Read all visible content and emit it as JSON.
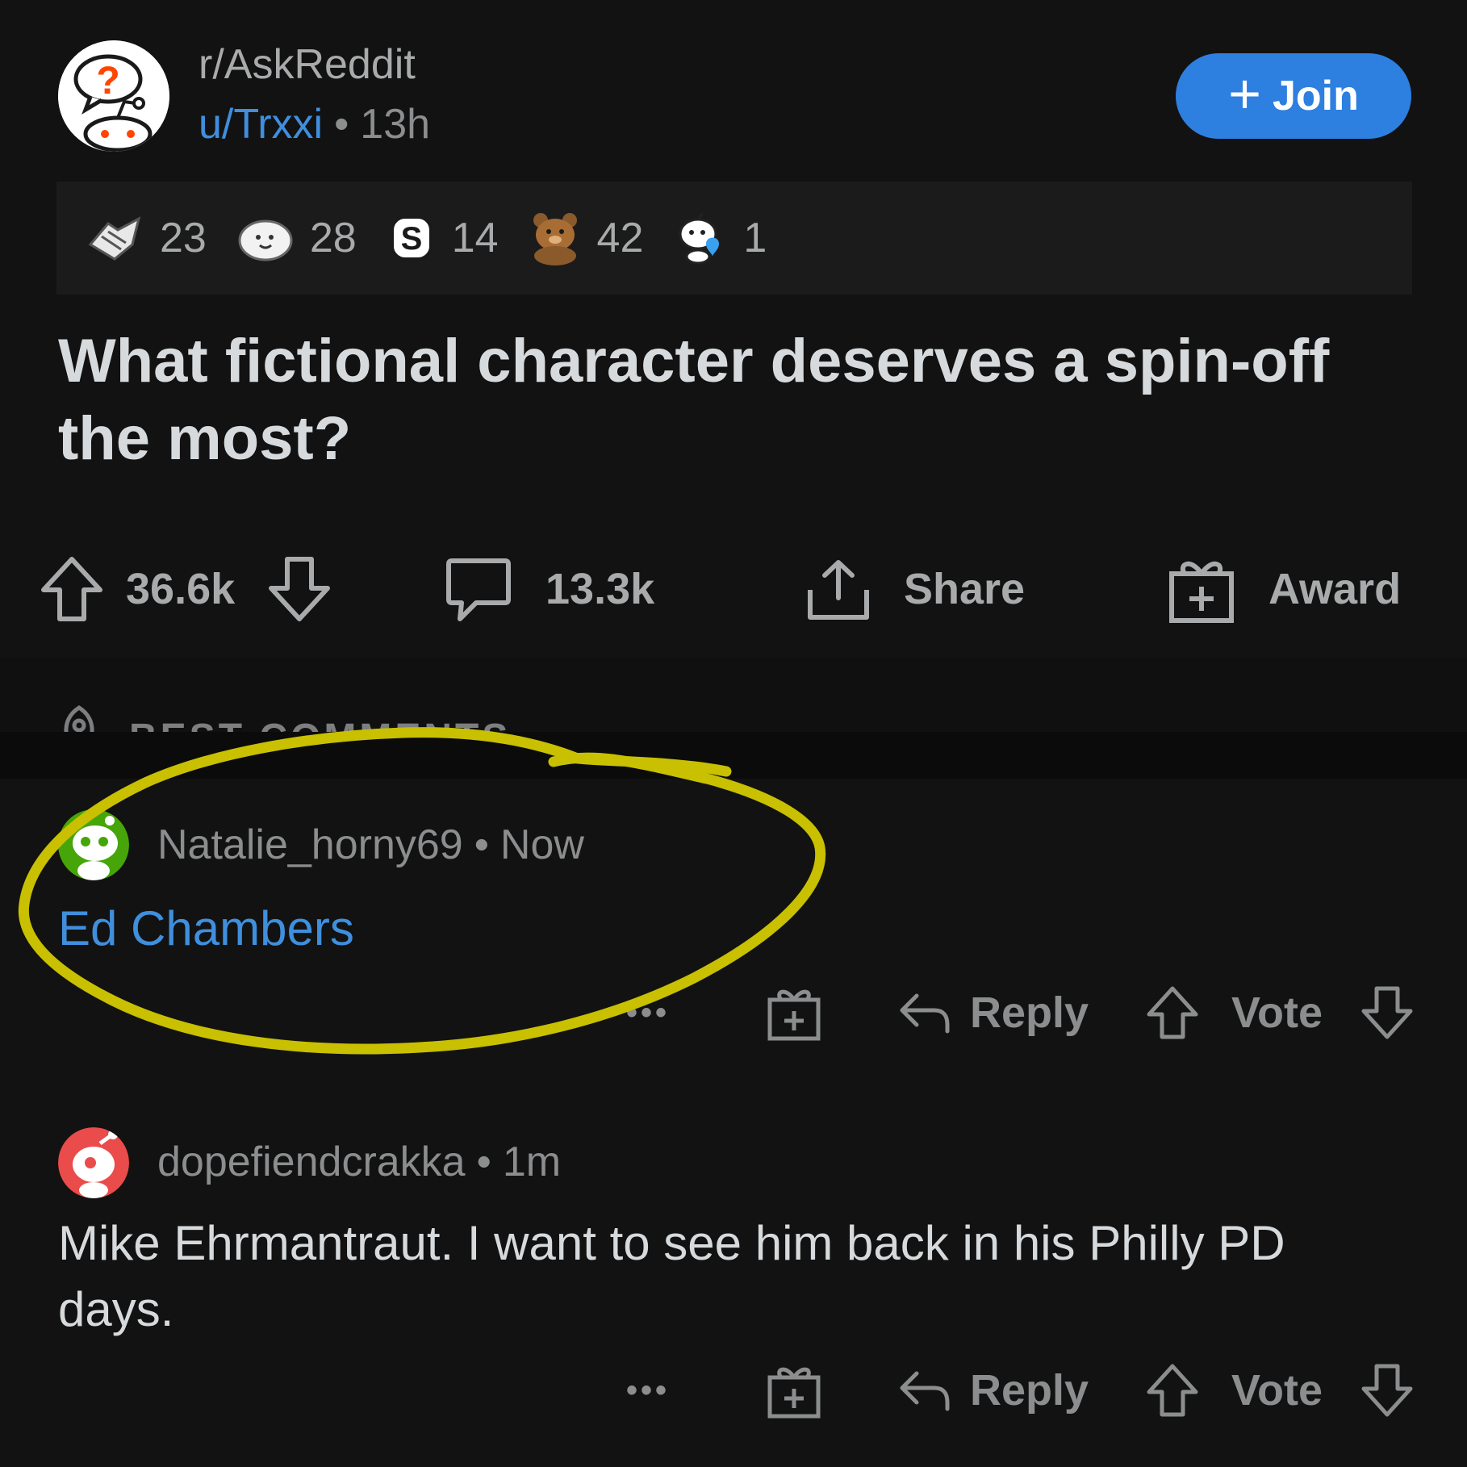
{
  "post": {
    "subreddit": "r/AskReddit",
    "author": "u/Trxxi",
    "age": "13h",
    "join_label": "Join",
    "title": "What fictional character deserves a spin-off the most?",
    "awards": [
      {
        "icon": "handshake-award-icon",
        "count": "23"
      },
      {
        "icon": "wholesome-seal-award-icon",
        "count": "28"
      },
      {
        "icon": "silver-coin-award-icon",
        "count": "14"
      },
      {
        "icon": "bear-award-icon",
        "count": "42"
      },
      {
        "icon": "snoo-heart-award-icon",
        "count": "1"
      }
    ],
    "upvotes": "36.6k",
    "comments": "13.3k",
    "share_label": "Share",
    "award_label": "Award"
  },
  "sort": {
    "label": "BEST COMMENTS"
  },
  "comments": [
    {
      "author": "Natalie_horny69",
      "age": "Now",
      "body": "Ed Chambers",
      "reply_label": "Reply",
      "vote_label": "Vote",
      "more_label": "•••"
    },
    {
      "author": "dopefiendcrakka",
      "age": "1m",
      "body": "Mike Ehrmantraut. I want to see him back in his Philly PD days.",
      "reply_label": "Reply",
      "vote_label": "Vote",
      "more_label": "•••"
    }
  ],
  "separator": "•",
  "colors": {
    "background": "#121212",
    "accent_blue": "#2d7fe0",
    "link_blue": "#3f8fdd",
    "highlight": "#c8c000",
    "text": "#d7dadc",
    "muted": "#8b8d8e"
  }
}
